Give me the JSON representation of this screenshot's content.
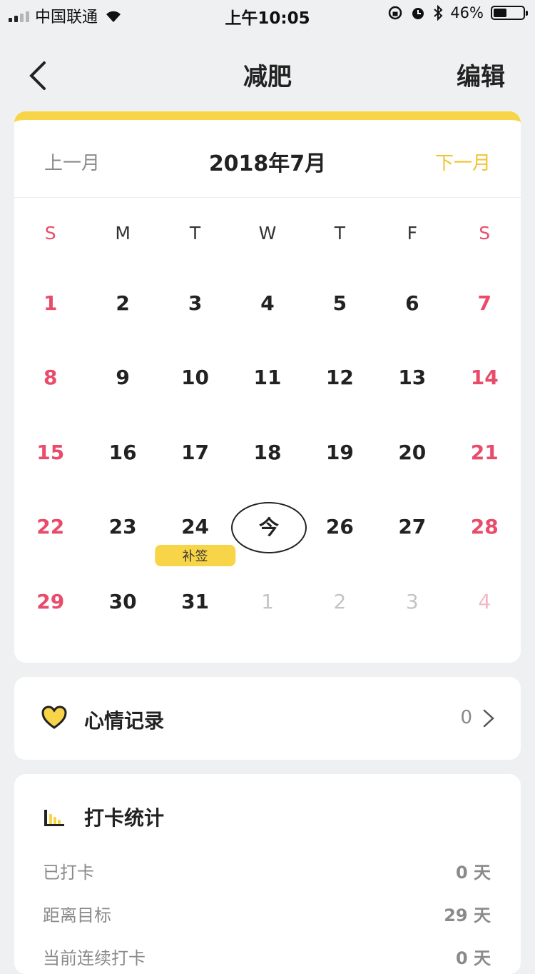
{
  "status_bar": {
    "carrier": "中国联通",
    "time": "上午10:05",
    "battery": "46%",
    "battery_level": 0.46
  },
  "nav": {
    "title": "减肥",
    "edit_label": "编辑"
  },
  "calendar": {
    "prev_label": "上一月",
    "month_title": "2018年7月",
    "next_label": "下一月",
    "weekdays": [
      "S",
      "M",
      "T",
      "W",
      "T",
      "F",
      "S"
    ],
    "weeks": [
      [
        "1",
        "2",
        "3",
        "4",
        "5",
        "6",
        "7"
      ],
      [
        "8",
        "9",
        "10",
        "11",
        "12",
        "13",
        "14"
      ],
      [
        "15",
        "16",
        "17",
        "18",
        "19",
        "20",
        "21"
      ],
      [
        "22",
        "23",
        "24",
        "今",
        "26",
        "27",
        "28"
      ],
      [
        "29",
        "30",
        "31",
        "1",
        "2",
        "3",
        "4"
      ]
    ],
    "makeup_tag": "补签",
    "today_label": "今"
  },
  "mood": {
    "label": "心情记录",
    "count": "0"
  },
  "stats": {
    "title": "打卡统计",
    "rows": [
      {
        "label": "已打卡",
        "value": "0 天"
      },
      {
        "label": "距离目标",
        "value": "29 天"
      },
      {
        "label": "当前连续打卡",
        "value": "0 天"
      }
    ]
  },
  "colors": {
    "accent": "#f8d548",
    "weekend": "#e94c6a",
    "next_month": "#f2c231"
  }
}
